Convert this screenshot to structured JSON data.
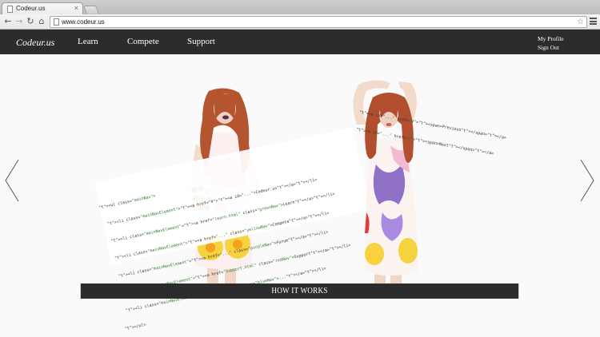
{
  "browser": {
    "tab_title": "Codeur.us",
    "tab_close": "×",
    "url": "www.codeur.us",
    "back": "←",
    "forward": "→",
    "reload": "↻",
    "home": "⌂",
    "star": "☆"
  },
  "header": {
    "logo": "Codeur.us",
    "nav": {
      "learn": "Learn",
      "compete": "Compete",
      "support": "Support"
    },
    "user": {
      "profile": "My Profile",
      "signout": "Sign Out"
    }
  },
  "hero": {
    "prev_arrow_icon": "chevron-left-icon",
    "next_arrow_icon": "chevron-right-icon",
    "code_left": [
      "<ul class=\"mainNav\">",
      "  <li class=\"mainNavElement\"><a href=\"#\"><a id=\"...\">Codeur.us</a></li>",
      "  <li class=\"mainNavElement\"><a href=\"learn.html\" class=\"greenNav\">Learn</a></li>",
      "  <li class=\"mainNavElement\"><a href=\"...\" class=\"yellowNav\">Compete</a></li>",
      "  <li class=\"mainNavElement\"><a href=\"...\" class=\"purpleNav\">Forum</a></li>",
      "  <li class=\"mainNavElement\"><a href=\"support.html\" class=\"redNav\">Support</a></li>",
      "  <li class=\"mainNavElement\"><a href=\"...\" class=\"blueNav\">...</a></li>",
      "</ul>"
    ],
    "code_right": [
      "<a id=\"...\" href=\"#\"><span>Previous</span></a>",
      "<a id=\"...\" href=\"#\"><span>Next</span></a>"
    ],
    "how_it_works": "HOW IT WORKS"
  },
  "colors": {
    "header_bg": "#2c2c2c",
    "code_tag": "#1b3fa6",
    "code_string": "#2f7a2f"
  }
}
